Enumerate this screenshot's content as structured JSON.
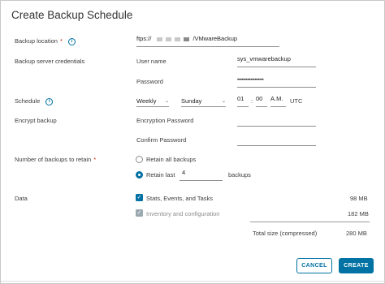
{
  "dialog": {
    "title": "Create Backup Schedule"
  },
  "backup_location": {
    "label": "Backup location",
    "required_marker": "*",
    "info_glyph": "i",
    "value_prefix": "ftps://",
    "value_suffix": "/VMwareBackup"
  },
  "credentials": {
    "label": "Backup server credentials",
    "username_label": "User name",
    "username_value": "sys_vmwarebackup",
    "password_label": "Password",
    "password_value": "••••••••••••••••••"
  },
  "schedule": {
    "label": "Schedule",
    "info_glyph": "i",
    "frequency": "Weekly",
    "day": "Sunday",
    "hour": "01",
    "separator": ":",
    "minute": "00",
    "ampm": "A.M.",
    "timezone": "UTC",
    "chevron": "⌄"
  },
  "encrypt": {
    "label": "Encrypt backup",
    "encryption_password_label": "Encryption Password",
    "confirm_password_label": "Confirm Password"
  },
  "retain": {
    "label": "Number of backups to retain",
    "required_marker": "*",
    "retain_all_label": "Retain all backups",
    "retain_last_label": "Retain last",
    "retain_last_value": "4",
    "backups_suffix": "backups",
    "selected": "retain_last"
  },
  "data": {
    "label": "Data",
    "items": [
      {
        "label": "Stats, Events, and Tasks",
        "size": "98 MB",
        "checked": true,
        "disabled": false
      },
      {
        "label": "Inventory and configuration",
        "size": "182 MB",
        "checked": true,
        "disabled": true
      }
    ],
    "check_glyph": "✓",
    "total_label": "Total size (compressed)",
    "total_value": "280 MB"
  },
  "footer": {
    "cancel_label": "CANCEL",
    "create_label": "CREATE"
  },
  "colors": {
    "accent": "#0072a3",
    "required": "#c92100",
    "muted": "#8c8c8c"
  }
}
